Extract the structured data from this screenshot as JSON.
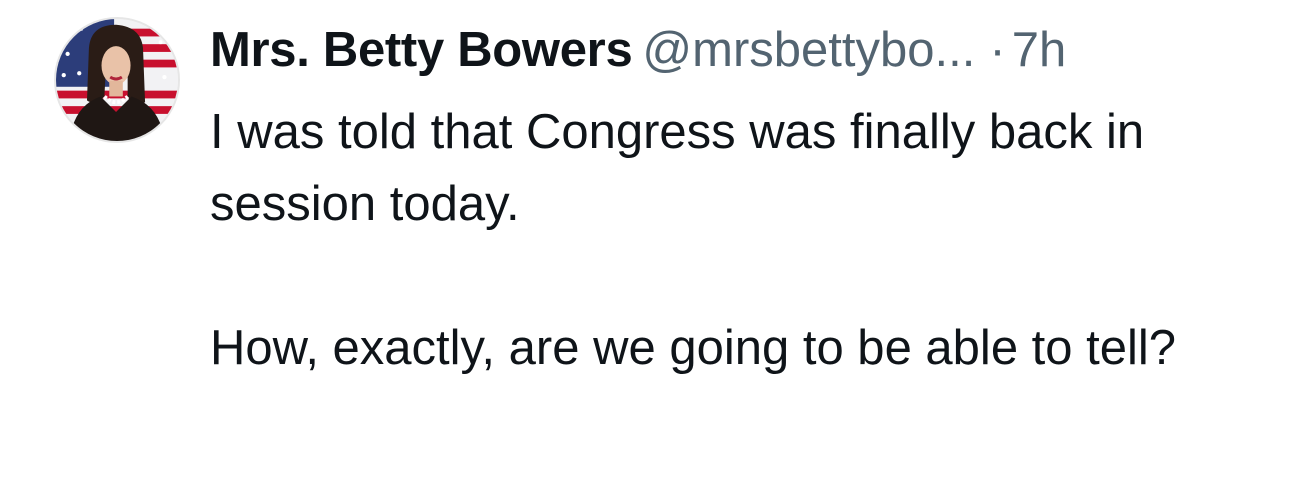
{
  "tweet": {
    "author": {
      "display_name": "Mrs. Betty Bowers",
      "handle": "@mrsbettybo...",
      "avatar": "profile-photo"
    },
    "separator": "·",
    "timestamp": "7h",
    "text": {
      "paragraph_1": "I was told that Congress was finally back in session today.",
      "paragraph_2": "How, exactly, are we going to be able to tell?"
    }
  },
  "colors": {
    "primary_text": "#0f1419",
    "secondary_text": "#536471",
    "background": "#ffffff"
  }
}
